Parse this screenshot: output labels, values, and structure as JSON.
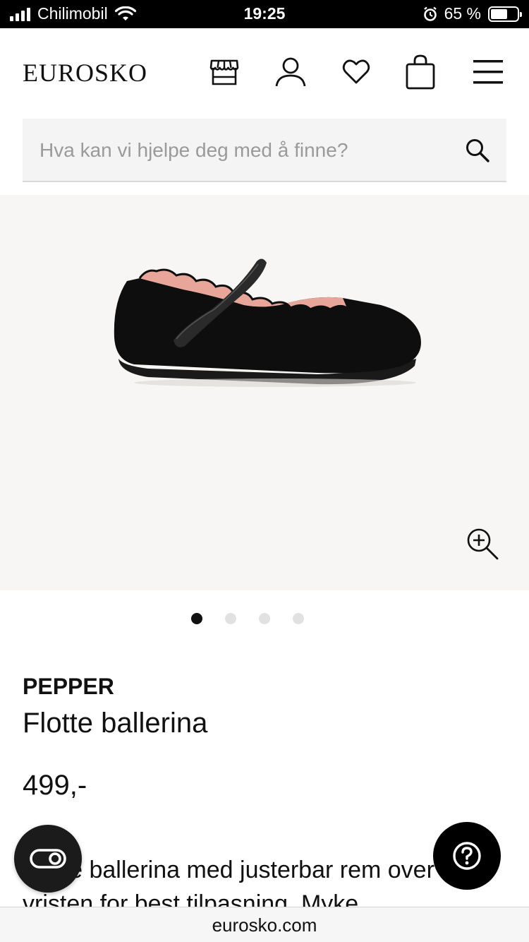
{
  "status_bar": {
    "carrier": "Chilimobil",
    "time": "19:25",
    "battery_percent": "65 %",
    "battery_level": 0.65
  },
  "header": {
    "logo": "EUROSKO",
    "icons": [
      "store-icon",
      "account-icon",
      "wishlist-heart-icon",
      "cart-bag-icon",
      "menu-hamburger-icon"
    ]
  },
  "search": {
    "placeholder": "Hva kan vi hjelpe deg med å finne?",
    "value": ""
  },
  "gallery": {
    "image_count": 4,
    "active_index": 0
  },
  "product": {
    "brand": "PEPPER",
    "name": "Flotte ballerina",
    "price": "499,-",
    "description": "Flotte ballerina med justerbar rem over vristen for best tilpasning. Myke"
  },
  "browser": {
    "url": "eurosko.com"
  },
  "colors": {
    "accent": "#111111",
    "gallery_bg": "#f7f6f4",
    "search_bg": "#f4f4f4"
  }
}
